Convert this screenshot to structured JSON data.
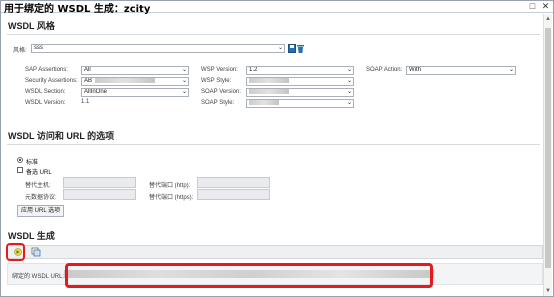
{
  "window": {
    "title": "用于绑定的 WSDL 生成：zcity",
    "restore_icon": "□",
    "close_icon": "✕"
  },
  "style_section": {
    "title": "WSDL 风格",
    "style_label": "风格:",
    "style_value": "sss",
    "save_icon": "save-icon",
    "delete_icon": "trash-icon"
  },
  "options": {
    "sap_assertions": {
      "label": "SAP Assertions:",
      "value": "All"
    },
    "security_assertions": {
      "label": "Security Assertions:",
      "value": "AB"
    },
    "wsdl_section": {
      "label": "WSDL Section:",
      "value": "AllInOne"
    },
    "wsdl_version": {
      "label": "WSDL Version:",
      "value": "1.1"
    },
    "wsp_version": {
      "label": "WSP Version:",
      "value": "1.2"
    },
    "wsp_style": {
      "label": "WSP Style:",
      "value": ""
    },
    "soap_version": {
      "label": "SOAP Version:",
      "value": ""
    },
    "soap_style": {
      "label": "SOAP Style:",
      "value": ""
    },
    "soap_action": {
      "label": "SOAP Action:",
      "value": "With"
    }
  },
  "access_section": {
    "title": "WSDL 访问和 URL 的选项",
    "radio_standard": "标准",
    "check_alt_url": "备选 URL",
    "alt_host": "替代主机:",
    "alt_proto": "元数据协议:",
    "alt_port_http": "替代端口 (http):",
    "alt_port_https": "替代端口 (https):",
    "apply_button": "应用 URL 选项"
  },
  "generation_section": {
    "title": "WSDL 生成",
    "url_label": "绑定的 WSDL URL:",
    "url_value": ""
  },
  "colors": {
    "highlight": "#e8191a",
    "accent": "#1f6fb5"
  }
}
